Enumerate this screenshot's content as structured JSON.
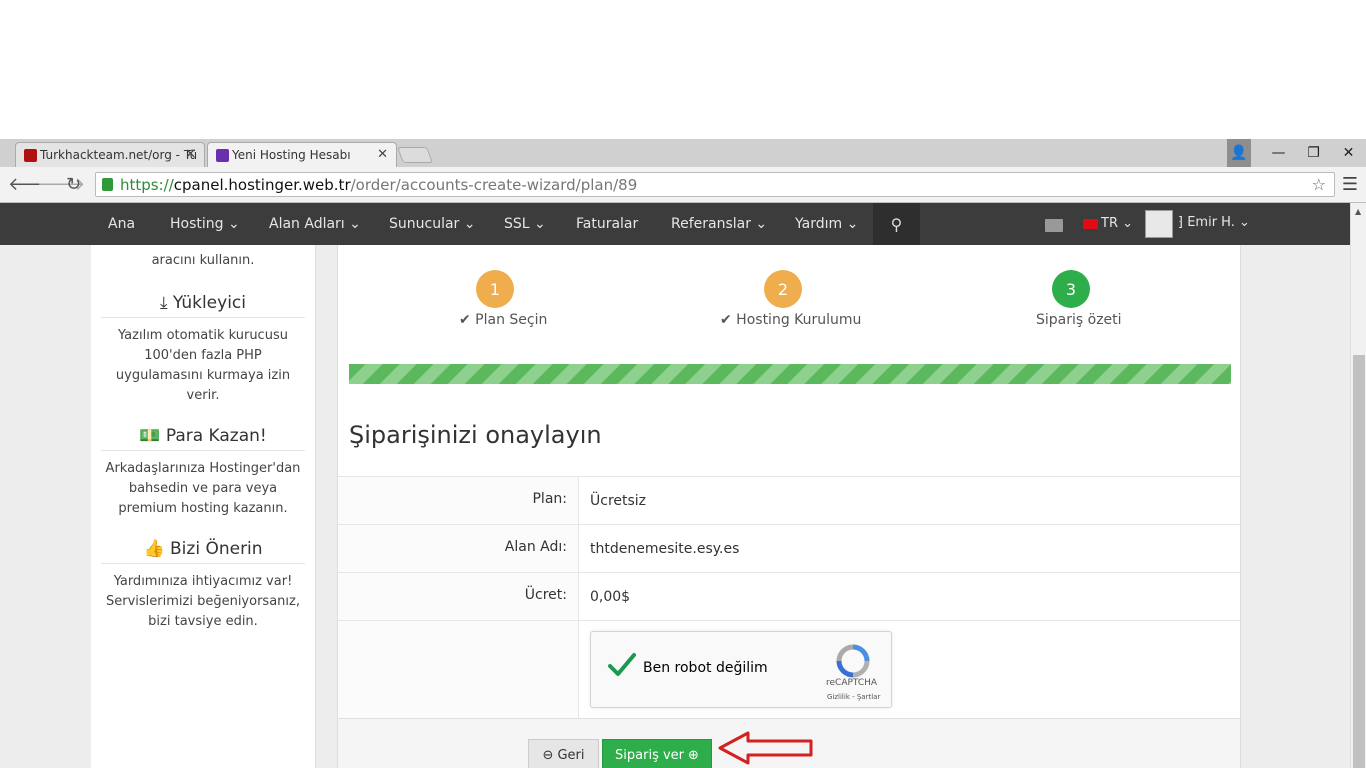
{
  "browser": {
    "tabs": [
      {
        "title": "Turkhackteam.net/org - Tü",
        "favicon_color": "#b01010",
        "active": false
      },
      {
        "title": "Yeni Hosting Hesabı",
        "favicon_color": "#6a2fb0",
        "active": true
      }
    ],
    "url": {
      "scheme": "https://",
      "host": "cpanel.hostinger.web.tr",
      "path": "/order/accounts-create-wizard/plan/89"
    },
    "tab_close_glyph": "✕",
    "back_glyph": "🡐",
    "forward_glyph": "🡒",
    "reload_glyph": "↻",
    "star_glyph": "☆",
    "menu_glyph": "☰",
    "min_glyph": "—",
    "restore_glyph": "❐",
    "close_glyph": "✕",
    "user_glyph": "👤"
  },
  "nav": {
    "items": [
      {
        "label": "Ana"
      },
      {
        "label": "Hosting ⌄"
      },
      {
        "label": "Alan Adları ⌄"
      },
      {
        "label": "Sunucular ⌄"
      },
      {
        "label": "SSL ⌄"
      },
      {
        "label": "Faturalar"
      },
      {
        "label": "Referanslar ⌄"
      },
      {
        "label": "Yardım ⌄"
      }
    ],
    "search_glyph": "⚲",
    "language": "TR ⌄",
    "user": "⁆ Emir H.  ⌄"
  },
  "sidebar": {
    "intro_text": "aracını kullanın.",
    "sections": [
      {
        "icon": "download-icon",
        "glyph": "⤓",
        "title": "Yükleyici",
        "text": "Yazılım otomatik kurucusu 100'den fazla PHP uygulamasını kurmaya izin verir."
      },
      {
        "icon": "money-icon",
        "glyph": "💵",
        "title": "Para Kazan!",
        "text": "Arkadaşlarınıza Hostinger'dan bahsedin ve para veya premium hosting kazanın."
      },
      {
        "icon": "thumbs-up-icon",
        "glyph": "👍",
        "title": "Bizi Önerin",
        "text": "Yardımınıza ihtiyacımız var! Servislerimizi beğeniyorsanız, bizi tavsiye edin."
      }
    ]
  },
  "wizard": {
    "steps": [
      {
        "number": "1",
        "label": "✔ Plan Seçin",
        "color": "#f0ad4e"
      },
      {
        "number": "2",
        "label": "✔ Hosting Kurulumu",
        "color": "#f0ad4e"
      },
      {
        "number": "3",
        "label": "Sipariş özeti",
        "color": "#2eae4a"
      }
    ],
    "progress_percent": 100,
    "title": "Şiparişinizi onaylayın",
    "rows": [
      {
        "label": "Plan:",
        "value": "Ücretsiz"
      },
      {
        "label": "Alan Adı:",
        "value": "thtdenemesite.esy.es"
      },
      {
        "label": "Ücret:",
        "value": "0,00$"
      }
    ],
    "captcha": {
      "text": "Ben robot değilim",
      "brand": "reCAPTCHA",
      "links": "Gizlilik - Şartlar",
      "checked": true
    },
    "back_button": "Geri",
    "back_glyph": "⊖",
    "order_button": "Sipariş ver",
    "order_glyph": "⊕"
  },
  "colors": {
    "nav_bg": "#3c3c3c",
    "accent_green": "#2eae4a",
    "step_orange": "#f0ad4e",
    "annotation_red": "#d42020"
  }
}
